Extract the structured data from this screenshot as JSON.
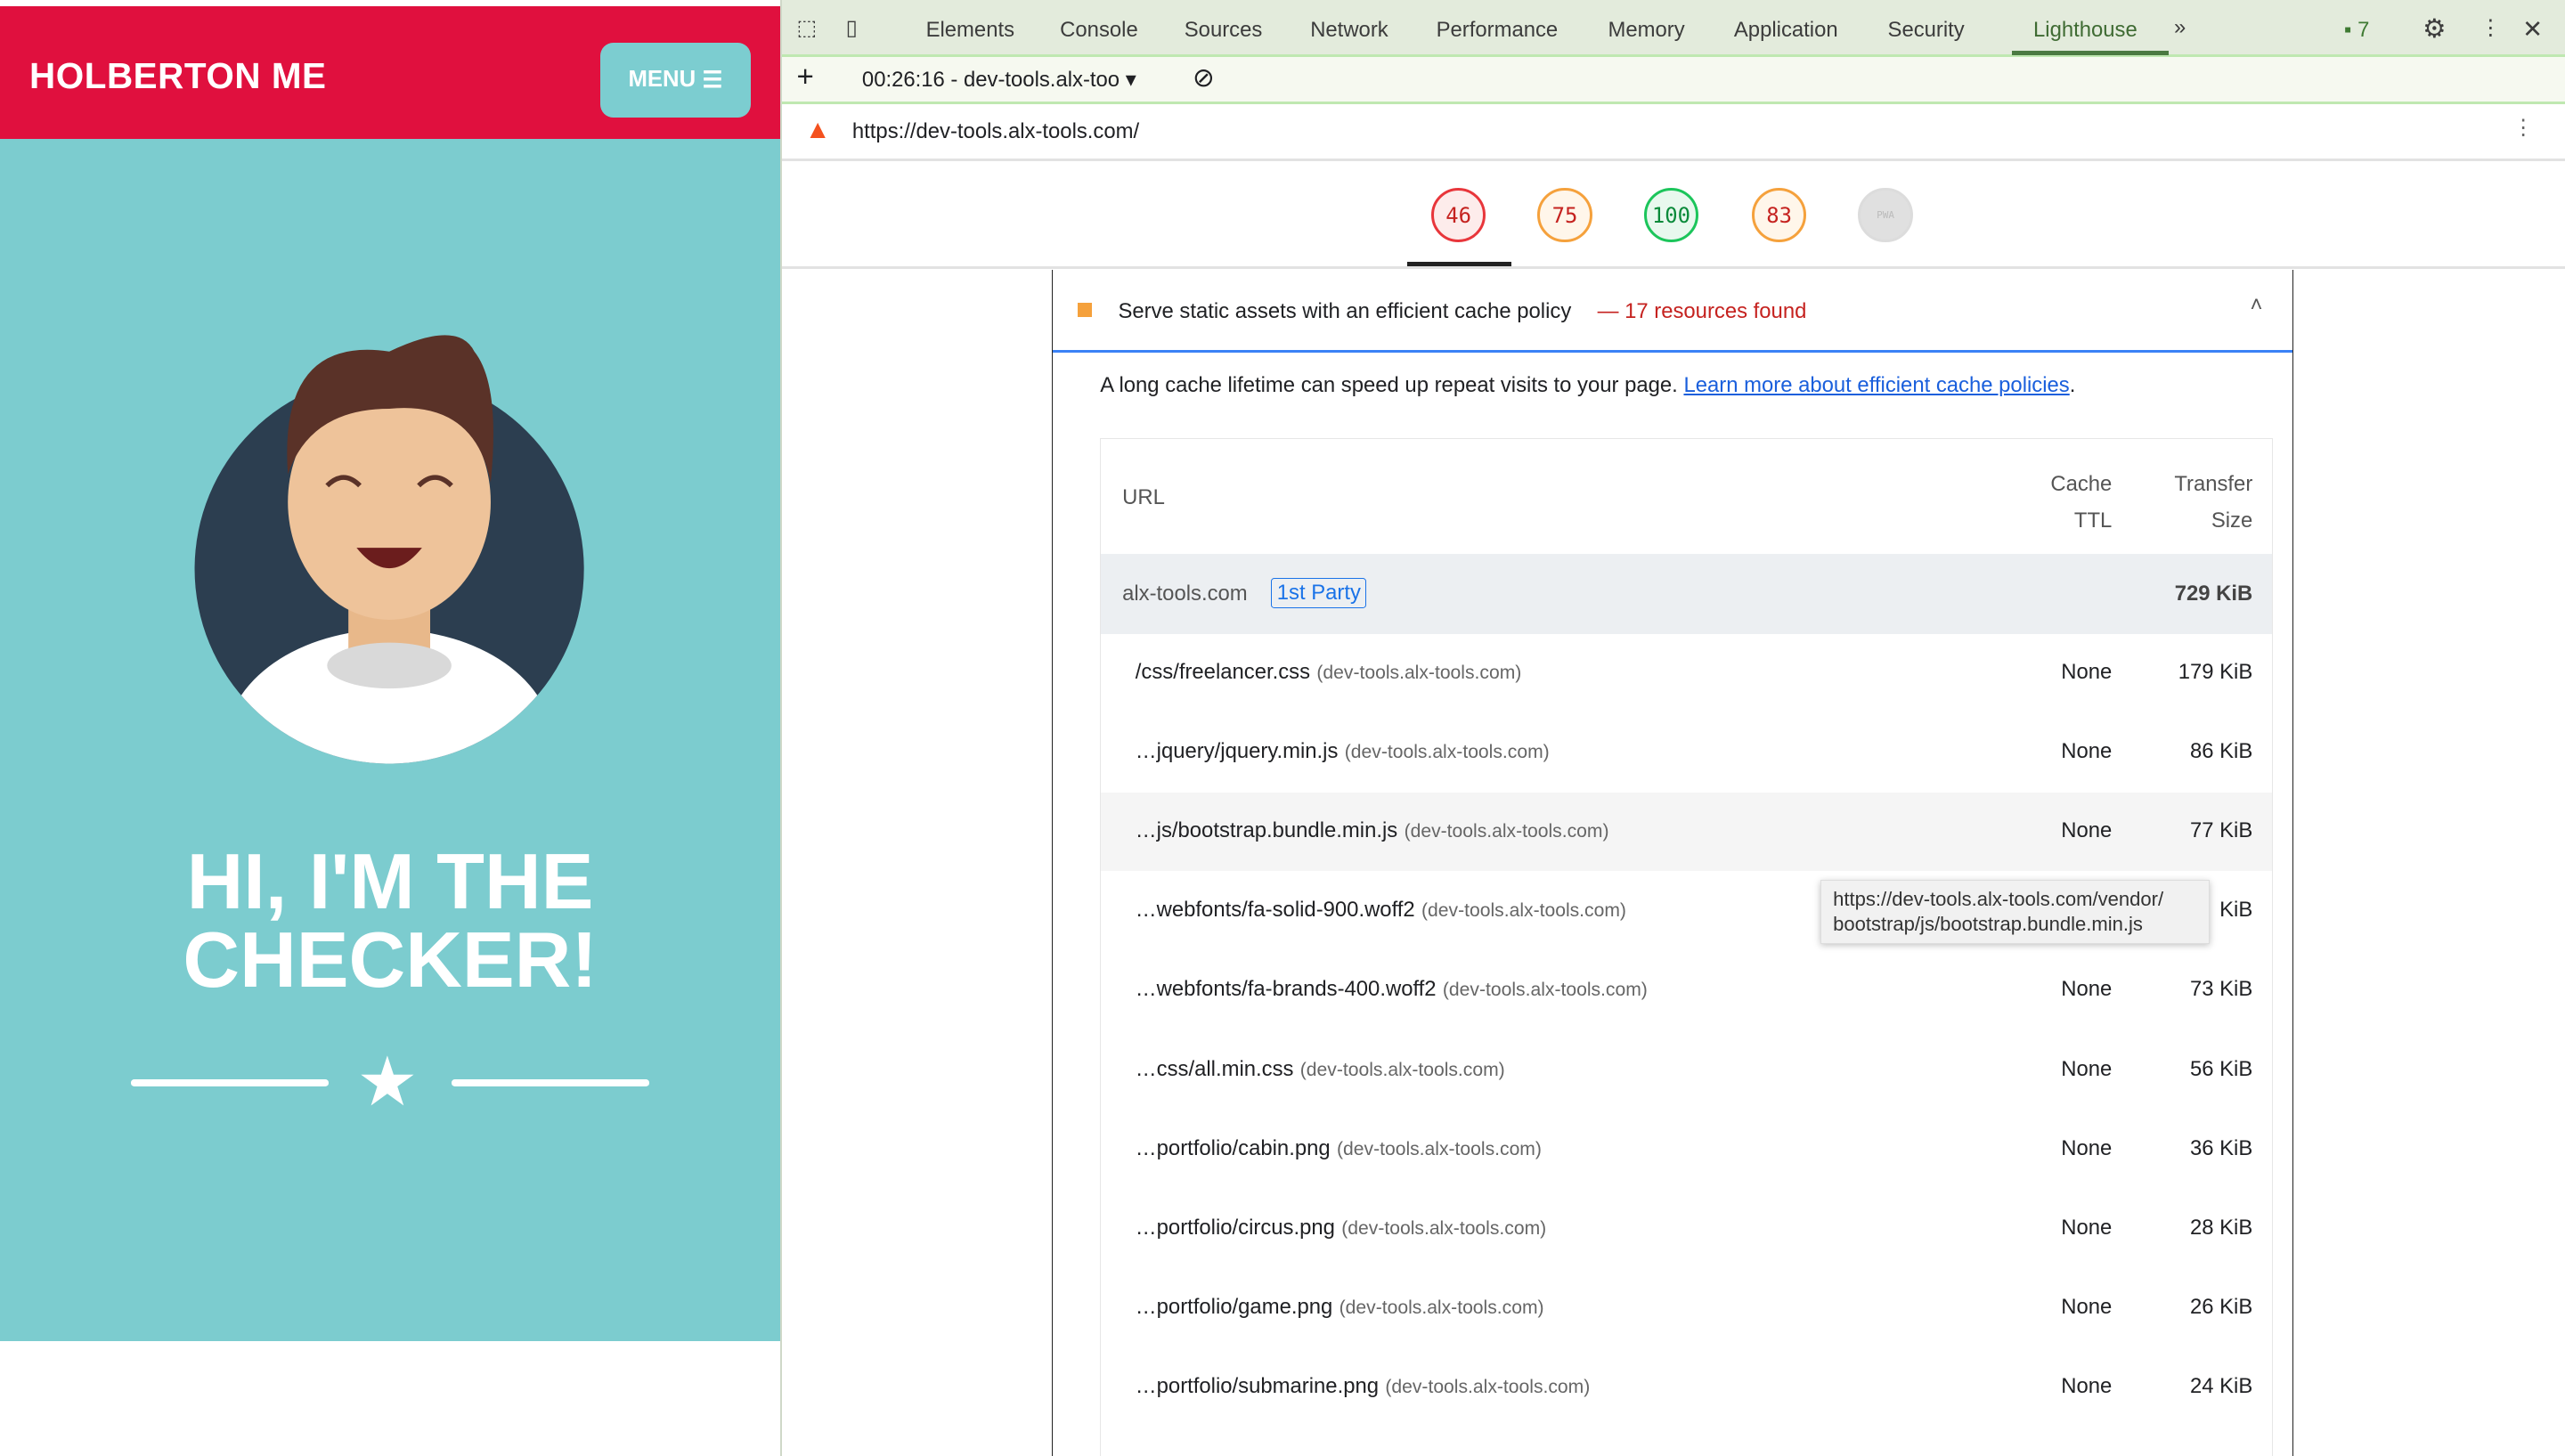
{
  "site": {
    "brand": "HOLBERTON ME",
    "menu_label": "MENU",
    "menu_icon": "hamburger-icon",
    "hero_title_line1": "HI, I'M THE",
    "hero_title_line2": "CHECKER!",
    "colors": {
      "header": "#e0103e",
      "hero": "#7ccccf"
    }
  },
  "devtools": {
    "tabs": [
      "Elements",
      "Console",
      "Sources",
      "Network",
      "Performance",
      "Memory",
      "Application",
      "Security",
      "Lighthouse"
    ],
    "active_tab": "Lighthouse",
    "issues_count": "7",
    "report_selector": "00:26:16 - dev-tools.alx-too",
    "url": "https://dev-tools.alx-tools.com/",
    "scores": [
      {
        "value": "46",
        "color": "#e8363b",
        "bg": "#fdeceb"
      },
      {
        "value": "75",
        "color": "#f5a13c",
        "bg": "#fff6ea"
      },
      {
        "value": "100",
        "color": "#1cc55b",
        "bg": "#e8f8ee"
      },
      {
        "value": "83",
        "color": "#f5a13c",
        "bg": "#fff6ea"
      },
      {
        "value": "PWA",
        "color": "#dcdcdc",
        "bg": "#e0e0e0"
      }
    ],
    "audit": {
      "title": "Serve static assets with an efficient cache policy",
      "separator": "—",
      "summary": "17 resources found",
      "description": "A long cache lifetime can speed up repeat visits to your page.",
      "link": "Learn more about efficient cache policies",
      "columns": {
        "url": "URL",
        "ttl_line1": "Cache",
        "ttl_line2": "TTL",
        "size_line1": "Transfer",
        "size_line2": "Size"
      },
      "group": {
        "domain": "alx-tools.com",
        "badge": "1st Party",
        "size": "729 KiB"
      },
      "rows": [
        {
          "url": "/css/freelancer.css",
          "host": "(dev-tools.alx-tools.com)",
          "ttl": "None",
          "size": "179 KiB"
        },
        {
          "url": "…jquery/jquery.min.js",
          "host": "(dev-tools.alx-tools.com)",
          "ttl": "None",
          "size": "86 KiB"
        },
        {
          "url": "…js/bootstrap.bundle.min.js",
          "host": "(dev-tools.alx-tools.com)",
          "ttl": "None",
          "size": "77 KiB"
        },
        {
          "url": "…webfonts/fa-solid-900.woff2",
          "host": "(dev-tools.alx-tools.com)",
          "ttl": "",
          "size": "KiB"
        },
        {
          "url": "…webfonts/fa-brands-400.woff2",
          "host": "(dev-tools.alx-tools.com)",
          "ttl": "None",
          "size": "73 KiB"
        },
        {
          "url": "…css/all.min.css",
          "host": "(dev-tools.alx-tools.com)",
          "ttl": "None",
          "size": "56 KiB"
        },
        {
          "url": "…portfolio/cabin.png",
          "host": "(dev-tools.alx-tools.com)",
          "ttl": "None",
          "size": "36 KiB"
        },
        {
          "url": "…portfolio/circus.png",
          "host": "(dev-tools.alx-tools.com)",
          "ttl": "None",
          "size": "28 KiB"
        },
        {
          "url": "…portfolio/game.png",
          "host": "(dev-tools.alx-tools.com)",
          "ttl": "None",
          "size": "26 KiB"
        },
        {
          "url": "…portfolio/submarine.png",
          "host": "(dev-tools.alx-tools.com)",
          "ttl": "None",
          "size": "24 KiB"
        }
      ],
      "tooltip_line1": "https://dev-tools.alx-tools.com/vendor/",
      "tooltip_line2": "bootstrap/js/bootstrap.bundle.min.js"
    }
  }
}
